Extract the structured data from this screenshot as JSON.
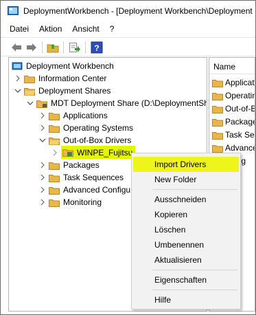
{
  "window": {
    "title": "DeploymentWorkbench - [Deployment Workbench\\Deployment"
  },
  "menubar": {
    "items": [
      "Datei",
      "Aktion",
      "Ansicht",
      "?"
    ]
  },
  "toolbar": {
    "buttons": [
      "back-arrow-icon",
      "forward-arrow-icon",
      "up-folder-icon",
      "export-list-icon",
      "help-icon"
    ]
  },
  "tree": {
    "root": "Deployment Workbench",
    "information_center": "Information Center",
    "deployment_shares": "Deployment Shares",
    "mdt_share": "MDT Deployment Share (D:\\DeploymentSh",
    "applications": "Applications",
    "operating_systems": "Operating Systems",
    "out_of_box_drivers": "Out-of-Box Drivers",
    "winpe_fujitsu": "WINPE_Fujitsu",
    "packages": "Packages",
    "task_sequences": "Task Sequences",
    "advanced_config": "Advanced Configu",
    "monitoring": "Monitoring"
  },
  "right_pane": {
    "header": "Name",
    "items": [
      "Applicatio",
      "Operating",
      "Out-of-B",
      "Packages",
      "Task Sequ",
      "Advance",
      "toring"
    ]
  },
  "context_menu": {
    "import_drivers": "Import Drivers",
    "new_folder": "New Folder",
    "cut": "Ausschneiden",
    "copy": "Kopieren",
    "delete": "Löschen",
    "rename": "Umbenennen",
    "refresh": "Aktualisieren",
    "properties": "Eigenschaften",
    "help": "Hilfe"
  },
  "colors": {
    "highlight": "#eef51a",
    "folder": "#e8b64a",
    "menu_bg": "#f2f2f2"
  }
}
